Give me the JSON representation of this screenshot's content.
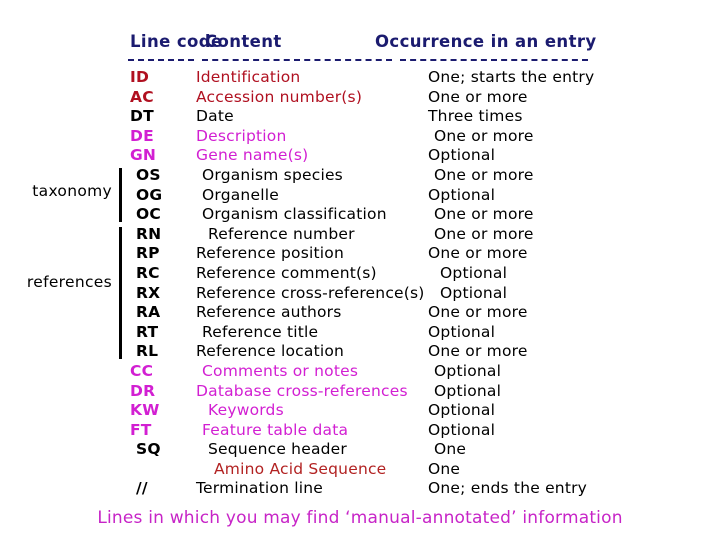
{
  "header": {
    "line_code": "Line code",
    "content": "Content",
    "occurrence": "Occurrence in an entry"
  },
  "colors": {
    "header_blue": "#1b1b6f",
    "red": "#b01020",
    "black": "#000000",
    "magenta": "#d21fd2",
    "crimson": "#b22222",
    "caption_magenta": "#c724c7"
  },
  "side_labels": {
    "taxonomy": "taxonomy",
    "references": "references"
  },
  "rows": [
    {
      "code": "ID",
      "content": "Identification",
      "occurrence": "One; starts the entry"
    },
    {
      "code": "AC",
      "content": "Accession number(s)",
      "occurrence": "One or more"
    },
    {
      "code": "DT",
      "content": "Date",
      "occurrence": "Three times"
    },
    {
      "code": "DE",
      "content": "Description",
      "occurrence": "One or more"
    },
    {
      "code": "GN",
      "content": "Gene name(s)",
      "occurrence": "Optional"
    },
    {
      "code": "OS",
      "content": "Organism species",
      "occurrence": "One or more"
    },
    {
      "code": "OG",
      "content": "Organelle",
      "occurrence": "Optional"
    },
    {
      "code": "OC",
      "content": "Organism classification",
      "occurrence": "One or more"
    },
    {
      "code": "RN",
      "content": "Reference number",
      "occurrence": "One or more"
    },
    {
      "code": "RP",
      "content": "Reference position",
      "occurrence": "One or more"
    },
    {
      "code": "RC",
      "content": "Reference comment(s)",
      "occurrence": "Optional"
    },
    {
      "code": "RX",
      "content": "Reference cross-reference(s)",
      "occurrence": "Optional"
    },
    {
      "code": "RA",
      "content": "Reference authors",
      "occurrence": "One or more"
    },
    {
      "code": "RT",
      "content": "Reference title",
      "occurrence": "Optional"
    },
    {
      "code": "RL",
      "content": "Reference location",
      "occurrence": "One or more"
    },
    {
      "code": "CC",
      "content": "Comments or notes",
      "occurrence": "Optional"
    },
    {
      "code": "DR",
      "content": "Database cross-references",
      "occurrence": "Optional"
    },
    {
      "code": "KW",
      "content": "Keywords",
      "occurrence": "Optional"
    },
    {
      "code": "FT",
      "content": "Feature table data",
      "occurrence": "Optional"
    },
    {
      "code": "SQ",
      "content": "Sequence header",
      "occurrence": "One"
    },
    {
      "code": "",
      "content": "Amino Acid Sequence",
      "occurrence": "One"
    },
    {
      "code": "//",
      "content": "Termination line",
      "occurrence": "One; ends the entry"
    }
  ],
  "caption": "Lines in which you may find ‘manual-annotated’ information"
}
